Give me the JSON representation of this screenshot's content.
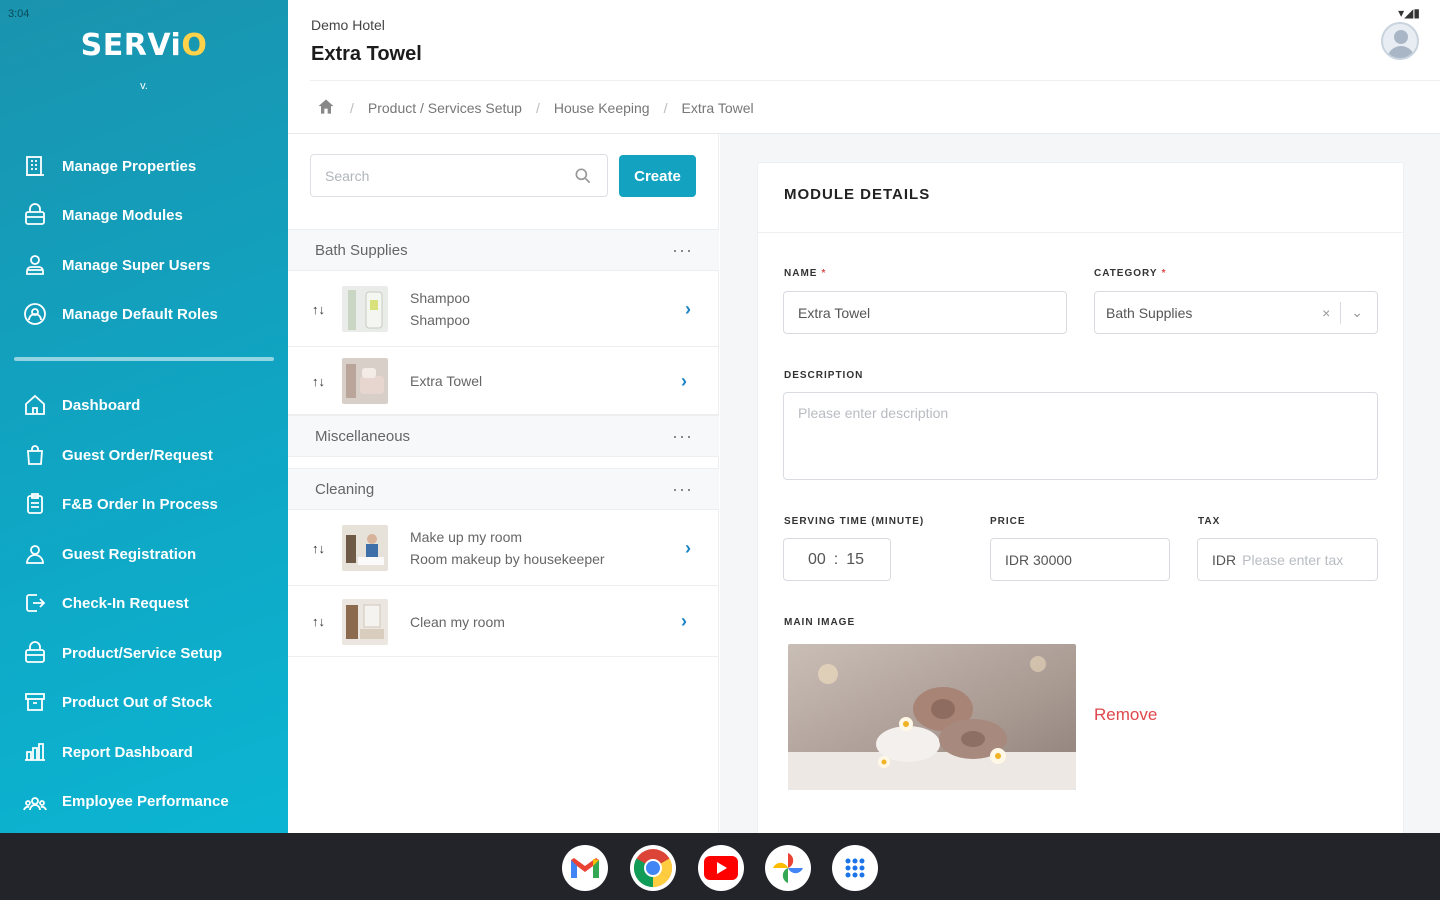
{
  "status_bar": {
    "time": "3:04",
    "icons": "▾◢▮"
  },
  "sidebar": {
    "logo_prefix": "SERV",
    "logo_i": "i",
    "logo_o": "O",
    "version": "v.",
    "top_items": [
      {
        "label": "Manage Properties",
        "icon": "building-icon"
      },
      {
        "label": "Manage Modules",
        "icon": "modules-icon"
      },
      {
        "label": "Manage Super Users",
        "icon": "users-icon"
      },
      {
        "label": "Manage Default Roles",
        "icon": "roles-icon"
      }
    ],
    "bottom_items": [
      {
        "label": "Dashboard",
        "icon": "home-icon"
      },
      {
        "label": "Guest Order/Request",
        "icon": "bag-icon"
      },
      {
        "label": "F&B Order In Process",
        "icon": "clipboard-icon"
      },
      {
        "label": "Guest Registration",
        "icon": "person-icon"
      },
      {
        "label": "Check-In Request",
        "icon": "checkin-icon"
      },
      {
        "label": "Product/Service Setup",
        "icon": "box-icon"
      },
      {
        "label": "Product Out of Stock",
        "icon": "archive-icon"
      },
      {
        "label": "Report Dashboard",
        "icon": "chart-icon"
      },
      {
        "label": "Employee Performance",
        "icon": "team-icon"
      }
    ]
  },
  "header": {
    "hotel": "Demo Hotel",
    "title": "Extra Towel"
  },
  "breadcrumb": {
    "items": [
      "Product / Services Setup",
      "House Keeping",
      "Extra Towel"
    ]
  },
  "list": {
    "search_placeholder": "Search",
    "create_label": "Create",
    "groups": [
      {
        "name": "Bath Supplies",
        "more": "···"
      },
      {
        "name": "Miscellaneous",
        "more": "···"
      },
      {
        "name": "Cleaning",
        "more": "···"
      }
    ],
    "items": [
      {
        "title": "Shampoo",
        "subtitle": "Shampoo"
      },
      {
        "title": "Extra Towel",
        "subtitle": ""
      },
      {
        "title": "Make up my room",
        "subtitle": "Room makeup by housekeeper"
      },
      {
        "title": "Clean my room",
        "subtitle": ""
      }
    ],
    "sort_glyph": "↑↓",
    "chevron": "›"
  },
  "details": {
    "title": "MODULE DETAILS",
    "name_label": "NAME",
    "name_value": "Extra Towel",
    "category_label": "CATEGORY",
    "category_value": "Bath Supplies",
    "clear_glyph": "×",
    "dropdown_glyph": "⌄",
    "description_label": "DESCRIPTION",
    "description_placeholder": "Please enter description",
    "serving_time_label": "SERVING TIME (MINUTE)",
    "serving_hours": "00",
    "serving_minutes": "15",
    "time_sep": ":",
    "price_label": "PRICE",
    "price_value": "IDR 30000",
    "tax_label": "TAX",
    "tax_prefix": "IDR",
    "tax_placeholder": "Please enter tax",
    "main_image_label": "MAIN IMAGE",
    "remove_label": "Remove",
    "required_mark": "*"
  },
  "taskbar": {
    "apps": [
      "gmail-icon",
      "chrome-icon",
      "youtube-icon",
      "photos-icon",
      "app-launcher-icon"
    ]
  },
  "colors": {
    "accent": "#13a3c1",
    "remove": "#e0474c",
    "chevron": "#1b84c4"
  }
}
